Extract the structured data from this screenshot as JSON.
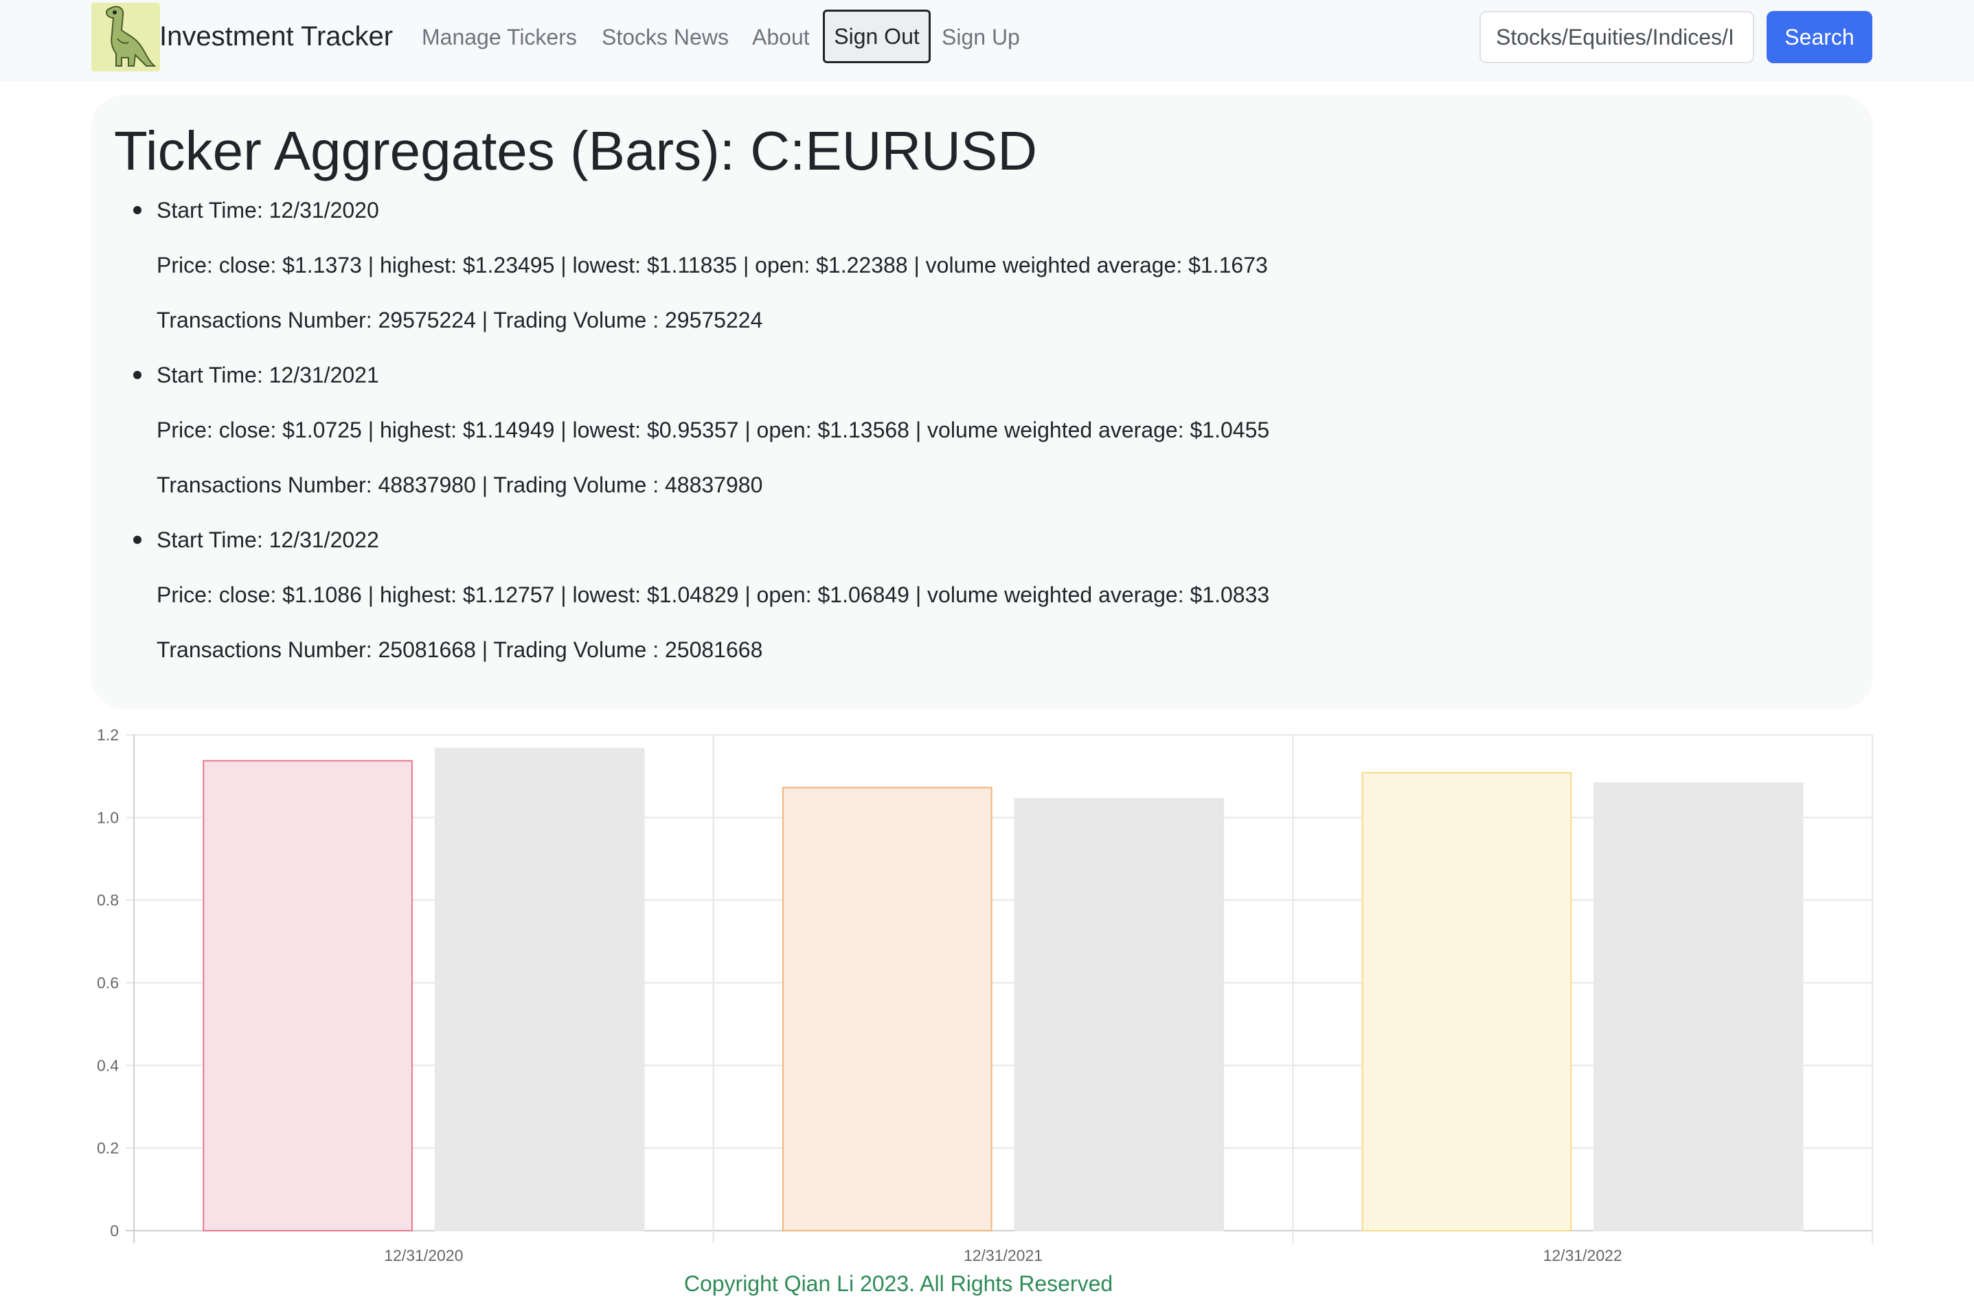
{
  "navbar": {
    "brand": "Investment Tracker",
    "logo_icon": "dinosaur-logo-icon",
    "links": [
      "Manage Tickers",
      "Stocks News",
      "About"
    ],
    "sign_out": "Sign Out",
    "sign_up": "Sign Up",
    "search_value": "Stocks/Equities/Indices/I",
    "search_button": "Search"
  },
  "main": {
    "title": "Ticker Aggregates (Bars): C:EURUSD",
    "aggregates": [
      {
        "start": "Start Time: 12/31/2020",
        "price": "Price: close: $1.1373 | highest: $1.23495 | lowest: $1.11835 | open: $1.22388 | volume weighted average: $1.1673",
        "volume": "Transactions Number: 29575224 | Trading Volume : 29575224"
      },
      {
        "start": "Start Time: 12/31/2021",
        "price": "Price: close: $1.0725 | highest: $1.14949 | lowest: $0.95357 | open: $1.13568 | volume weighted average: $1.0455",
        "volume": "Transactions Number: 48837980 | Trading Volume : 48837980"
      },
      {
        "start": "Start Time: 12/31/2022",
        "price": "Price: close: $1.1086 | highest: $1.12757 | lowest: $1.04829 | open: $1.06849 | volume weighted average: $1.0833",
        "volume": "Transactions Number: 25081668 | Trading Volume : 25081668"
      }
    ]
  },
  "chart_data": {
    "type": "bar",
    "categories": [
      "12/31/2020",
      "12/31/2021",
      "12/31/2022"
    ],
    "series": [
      {
        "values": [
          1.1373,
          1.0725,
          1.1086
        ],
        "fill_colors": [
          "#f8e1e7",
          "#f9ebdd",
          "#fcf6e0"
        ],
        "border_colors": [
          "#e8788c",
          "#f0b47c",
          "#f6dc8a"
        ]
      },
      {
        "values": [
          1.1673,
          1.0455,
          1.0833
        ],
        "fill_colors": [
          "#e8e8e8",
          "#e8e8e8",
          "#e8e8e8"
        ],
        "border_colors": [
          "#e8e8e8",
          "#e8e8e8",
          "#e8e8e8"
        ]
      }
    ],
    "y_ticks": [
      "0",
      "0.2",
      "0.4",
      "0.6",
      "0.8",
      "1.0",
      "1.2"
    ],
    "ylim": [
      0,
      1.2
    ],
    "grid": true,
    "legend": "none"
  },
  "footer": {
    "text": "Copyright Qian Li 2023. All Rights Reserved"
  }
}
